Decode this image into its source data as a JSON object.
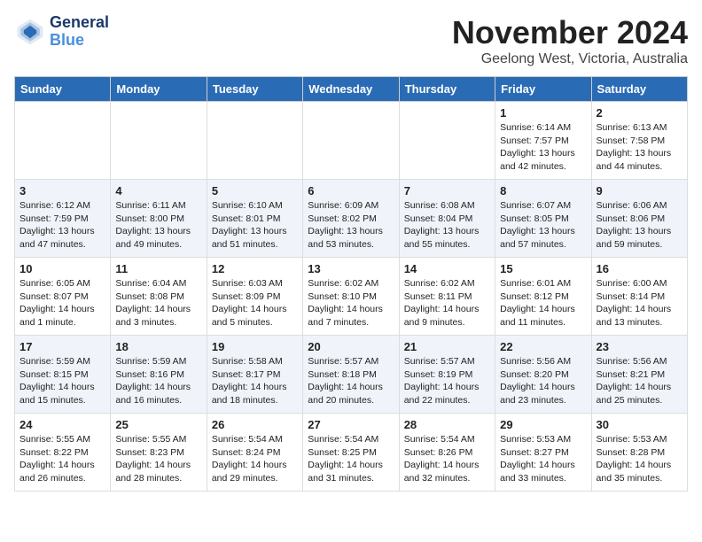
{
  "header": {
    "logo_line1": "General",
    "logo_line2": "Blue",
    "title": "November 2024",
    "subtitle": "Geelong West, Victoria, Australia"
  },
  "days_of_week": [
    "Sunday",
    "Monday",
    "Tuesday",
    "Wednesday",
    "Thursday",
    "Friday",
    "Saturday"
  ],
  "weeks": [
    [
      {
        "day": "",
        "info": ""
      },
      {
        "day": "",
        "info": ""
      },
      {
        "day": "",
        "info": ""
      },
      {
        "day": "",
        "info": ""
      },
      {
        "day": "",
        "info": ""
      },
      {
        "day": "1",
        "info": "Sunrise: 6:14 AM\nSunset: 7:57 PM\nDaylight: 13 hours\nand 42 minutes."
      },
      {
        "day": "2",
        "info": "Sunrise: 6:13 AM\nSunset: 7:58 PM\nDaylight: 13 hours\nand 44 minutes."
      }
    ],
    [
      {
        "day": "3",
        "info": "Sunrise: 6:12 AM\nSunset: 7:59 PM\nDaylight: 13 hours\nand 47 minutes."
      },
      {
        "day": "4",
        "info": "Sunrise: 6:11 AM\nSunset: 8:00 PM\nDaylight: 13 hours\nand 49 minutes."
      },
      {
        "day": "5",
        "info": "Sunrise: 6:10 AM\nSunset: 8:01 PM\nDaylight: 13 hours\nand 51 minutes."
      },
      {
        "day": "6",
        "info": "Sunrise: 6:09 AM\nSunset: 8:02 PM\nDaylight: 13 hours\nand 53 minutes."
      },
      {
        "day": "7",
        "info": "Sunrise: 6:08 AM\nSunset: 8:04 PM\nDaylight: 13 hours\nand 55 minutes."
      },
      {
        "day": "8",
        "info": "Sunrise: 6:07 AM\nSunset: 8:05 PM\nDaylight: 13 hours\nand 57 minutes."
      },
      {
        "day": "9",
        "info": "Sunrise: 6:06 AM\nSunset: 8:06 PM\nDaylight: 13 hours\nand 59 minutes."
      }
    ],
    [
      {
        "day": "10",
        "info": "Sunrise: 6:05 AM\nSunset: 8:07 PM\nDaylight: 14 hours\nand 1 minute."
      },
      {
        "day": "11",
        "info": "Sunrise: 6:04 AM\nSunset: 8:08 PM\nDaylight: 14 hours\nand 3 minutes."
      },
      {
        "day": "12",
        "info": "Sunrise: 6:03 AM\nSunset: 8:09 PM\nDaylight: 14 hours\nand 5 minutes."
      },
      {
        "day": "13",
        "info": "Sunrise: 6:02 AM\nSunset: 8:10 PM\nDaylight: 14 hours\nand 7 minutes."
      },
      {
        "day": "14",
        "info": "Sunrise: 6:02 AM\nSunset: 8:11 PM\nDaylight: 14 hours\nand 9 minutes."
      },
      {
        "day": "15",
        "info": "Sunrise: 6:01 AM\nSunset: 8:12 PM\nDaylight: 14 hours\nand 11 minutes."
      },
      {
        "day": "16",
        "info": "Sunrise: 6:00 AM\nSunset: 8:14 PM\nDaylight: 14 hours\nand 13 minutes."
      }
    ],
    [
      {
        "day": "17",
        "info": "Sunrise: 5:59 AM\nSunset: 8:15 PM\nDaylight: 14 hours\nand 15 minutes."
      },
      {
        "day": "18",
        "info": "Sunrise: 5:59 AM\nSunset: 8:16 PM\nDaylight: 14 hours\nand 16 minutes."
      },
      {
        "day": "19",
        "info": "Sunrise: 5:58 AM\nSunset: 8:17 PM\nDaylight: 14 hours\nand 18 minutes."
      },
      {
        "day": "20",
        "info": "Sunrise: 5:57 AM\nSunset: 8:18 PM\nDaylight: 14 hours\nand 20 minutes."
      },
      {
        "day": "21",
        "info": "Sunrise: 5:57 AM\nSunset: 8:19 PM\nDaylight: 14 hours\nand 22 minutes."
      },
      {
        "day": "22",
        "info": "Sunrise: 5:56 AM\nSunset: 8:20 PM\nDaylight: 14 hours\nand 23 minutes."
      },
      {
        "day": "23",
        "info": "Sunrise: 5:56 AM\nSunset: 8:21 PM\nDaylight: 14 hours\nand 25 minutes."
      }
    ],
    [
      {
        "day": "24",
        "info": "Sunrise: 5:55 AM\nSunset: 8:22 PM\nDaylight: 14 hours\nand 26 minutes."
      },
      {
        "day": "25",
        "info": "Sunrise: 5:55 AM\nSunset: 8:23 PM\nDaylight: 14 hours\nand 28 minutes."
      },
      {
        "day": "26",
        "info": "Sunrise: 5:54 AM\nSunset: 8:24 PM\nDaylight: 14 hours\nand 29 minutes."
      },
      {
        "day": "27",
        "info": "Sunrise: 5:54 AM\nSunset: 8:25 PM\nDaylight: 14 hours\nand 31 minutes."
      },
      {
        "day": "28",
        "info": "Sunrise: 5:54 AM\nSunset: 8:26 PM\nDaylight: 14 hours\nand 32 minutes."
      },
      {
        "day": "29",
        "info": "Sunrise: 5:53 AM\nSunset: 8:27 PM\nDaylight: 14 hours\nand 33 minutes."
      },
      {
        "day": "30",
        "info": "Sunrise: 5:53 AM\nSunset: 8:28 PM\nDaylight: 14 hours\nand 35 minutes."
      }
    ]
  ]
}
